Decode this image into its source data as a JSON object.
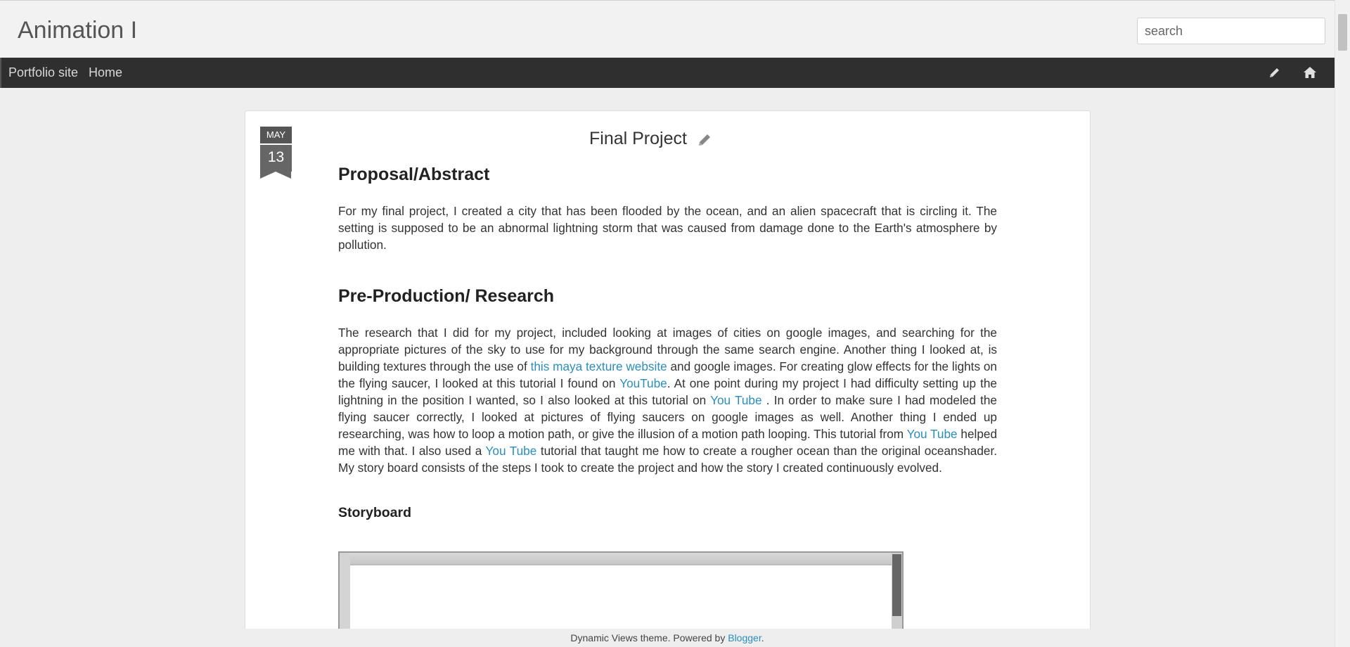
{
  "header": {
    "blog_title": "Animation I",
    "search_placeholder": "search"
  },
  "nav": {
    "items": [
      {
        "label": "Portfolio site"
      },
      {
        "label": "Home"
      }
    ],
    "icons": [
      "pencil-icon",
      "home-icon"
    ]
  },
  "post": {
    "date": {
      "month": "MAY",
      "day": "13"
    },
    "title": "Final Project",
    "sections": {
      "proposal_heading": "Proposal/Abstract",
      "proposal_text": "For my final project, I created a city that has been flooded by the ocean, and an alien spacecraft that is circling it. The setting is supposed to be an abnormal lightning storm that was caused from damage done to the Earth's atmosphere by pollution.",
      "research_heading": "Pre-Production/ Research",
      "research": {
        "t1": "The research that I did for my project, included looking at images of cities on google images, and searching for the appropriate pictures of the sky to use for my background through the same search engine.  Another thing I looked at, is building textures through the use of ",
        "link1": "this maya texture website",
        "t2": " and google images. For creating glow effects for the lights on the flying saucer, I looked at this tutorial I found on ",
        "link2": "YouTube",
        "t3": ". At one point during my project I had difficulty setting up the lightning in the position I wanted, so I also looked at this tutorial on ",
        "link3": "You Tube",
        "t4": " . In order to make sure I had modeled the flying saucer correctly, I looked at pictures of flying saucers on google images as well. Another thing I ended up researching, was how to loop a motion path, or give the illusion of a motion path looping. This tutorial from  ",
        "link4": "You Tube",
        "t5": " helped me with that. I also used a ",
        "link5": "You Tube",
        "t6": " tutorial that taught me how to create a rougher ocean than the original oceanshader. My story board consists of the steps I took to create the project and how the story I created continuously evolved."
      },
      "storyboard_heading": "Storyboard"
    }
  },
  "footer": {
    "text": "Dynamic Views theme. Powered by ",
    "link": "Blogger",
    "suffix": "."
  },
  "colors": {
    "link": "#2a8dbd",
    "navbar": "#2f2f2f",
    "background": "#eeeeee"
  }
}
